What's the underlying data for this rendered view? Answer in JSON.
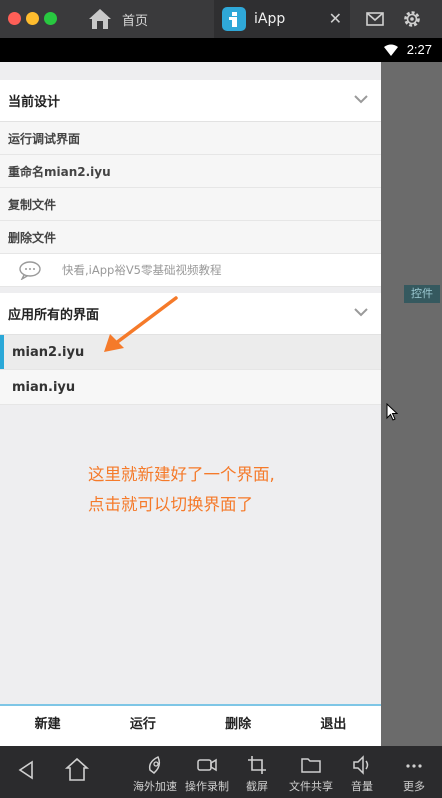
{
  "window": {
    "home_tab_label": "首页",
    "app_tab_label": "iApp",
    "close_glyph": "✕"
  },
  "statusbar": {
    "time": "2:27"
  },
  "overlay": {
    "control_tag": "控件"
  },
  "drawer": {
    "current_design": {
      "title": "当前设计",
      "items": [
        "运行调试界面",
        "重命名mian2.iyu",
        "复制文件",
        "删除文件"
      ],
      "tip": "快看,iApp裕V5零基础视频教程"
    },
    "all_ui": {
      "title": "应用所有的界面",
      "items": [
        "mian2.iyu",
        "mian.iyu"
      ],
      "active_index": 0
    },
    "annotation_line1": "这里就新建好了一个界面,",
    "annotation_line2": "点击就可以切换界面了",
    "actions": [
      "新建",
      "运行",
      "删除",
      "退出"
    ]
  },
  "navbar": {
    "items": [
      "海外加速",
      "操作录制",
      "截屏",
      "文件共享",
      "音量",
      "更多"
    ]
  },
  "colors": {
    "accent": "#2aa8d8",
    "annotation": "#f57a2a"
  }
}
